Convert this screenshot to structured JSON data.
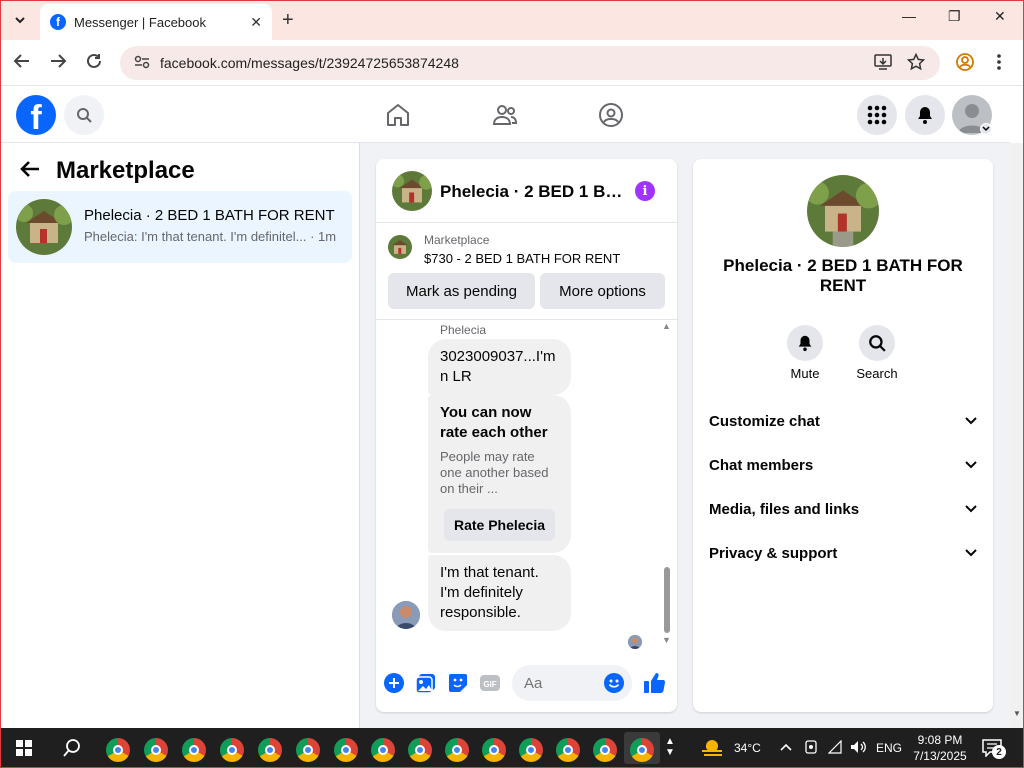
{
  "browser": {
    "tab_title": "Messenger | Facebook",
    "url": "facebook.com/messages/t/23924725653874248"
  },
  "marketplace": {
    "heading": "Marketplace",
    "conversation": {
      "name": "Phelecia · 2 BED 1 BATH FOR RENT",
      "preview": "Phelecia: I'm that tenant. I'm definitel... · 1m"
    }
  },
  "chat": {
    "title": "Phelecia · 2 BED 1 BA...",
    "listing_label": "Marketplace",
    "listing_price": "$730 - 2 BED 1 BATH FOR RENT",
    "mark_pending": "Mark as pending",
    "more_options": "More options",
    "sender": "Phelecia",
    "msg1": "3023009037...I'm n LR",
    "rating_title": "You can now rate each other",
    "rating_sub": "People may rate one another based on their ...",
    "rate_button": "Rate Phelecia",
    "msg3": "I'm that tenant. I'm definitely responsible.",
    "composer_placeholder": "Aa"
  },
  "info": {
    "name": "Phelecia · 2 BED 1 BATH FOR RENT",
    "mute": "Mute",
    "search": "Search",
    "sections": [
      "Customize chat",
      "Chat members",
      "Media, files and links",
      "Privacy & support"
    ]
  },
  "taskbar": {
    "temperature": "34°C",
    "language": "ENG",
    "time": "9:08 PM",
    "date": "7/13/2025",
    "notifications": "2"
  },
  "colors": {
    "brand": "#0866ff",
    "info_accent": "#a033ff",
    "selected_conversation": "#ebf5ff"
  }
}
